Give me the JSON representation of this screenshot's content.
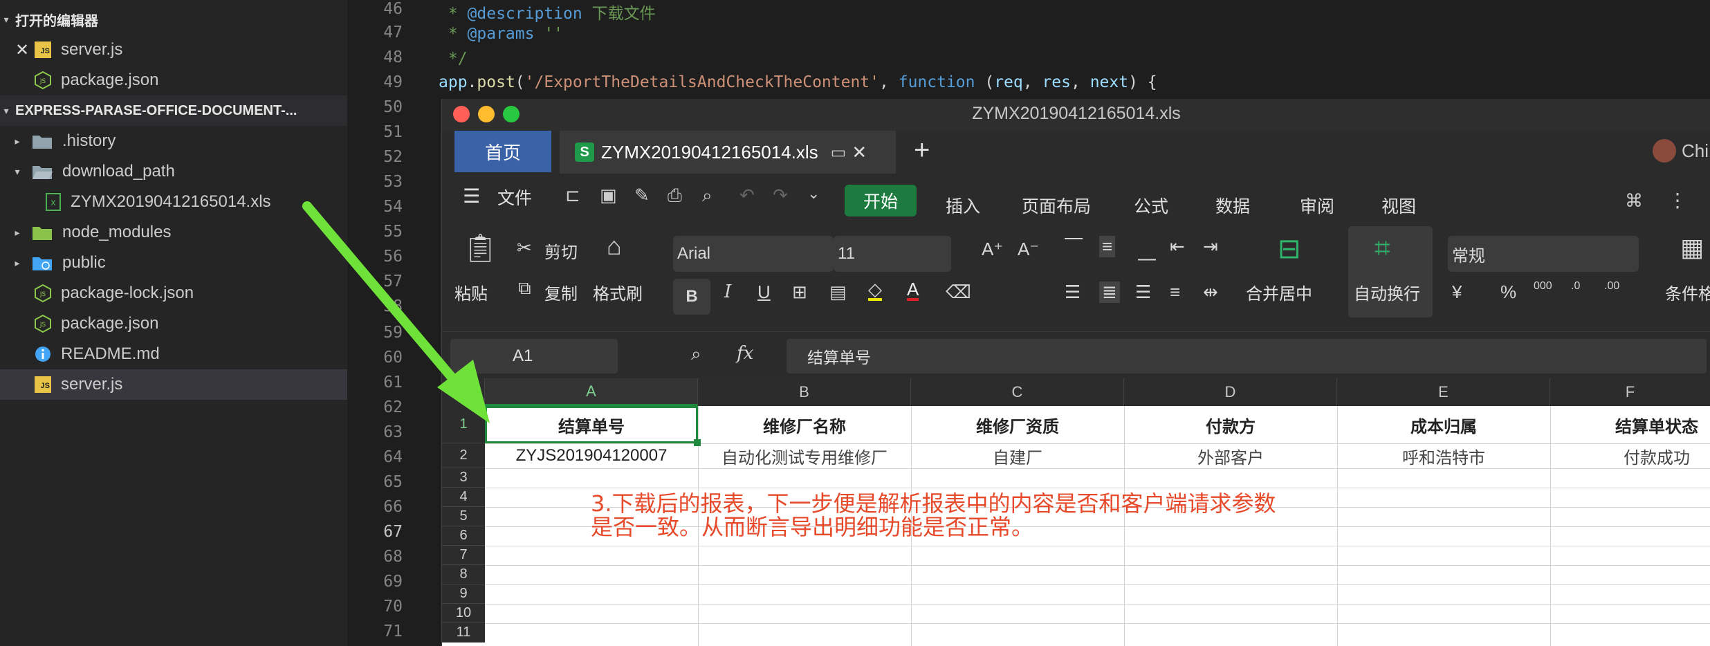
{
  "sidebar": {
    "open_editors_title": "打开的编辑器",
    "open_editors": [
      {
        "label": "server.js",
        "icon": "js-file-icon"
      },
      {
        "label": "package.json",
        "icon": "node-file-icon"
      }
    ],
    "project_title": "EXPRESS-PARASE-OFFICE-DOCUMENT-...",
    "tree": [
      {
        "label": ".history",
        "icon": "folder-icon"
      },
      {
        "label": "download_path",
        "icon": "folder-open-icon"
      },
      {
        "label": "ZYMX20190412165014.xls",
        "icon": "excel-file-icon"
      },
      {
        "label": "node_modules",
        "icon": "node-folder-icon"
      },
      {
        "label": "public",
        "icon": "web-folder-icon"
      },
      {
        "label": "package-lock.json",
        "icon": "node-file-icon"
      },
      {
        "label": "package.json",
        "icon": "node-file-icon"
      },
      {
        "label": "README.md",
        "icon": "info-icon"
      },
      {
        "label": "server.js",
        "icon": "js-file-icon"
      }
    ]
  },
  "editor": {
    "line_numbers": [
      "46",
      "47",
      "48",
      "49",
      "50",
      "51",
      "52",
      "53",
      "54",
      "55",
      "56",
      "57",
      "58",
      "59",
      "60",
      "61",
      "62",
      "63",
      "64",
      "65",
      "66",
      "67",
      "68",
      "69",
      "70",
      "71"
    ],
    "current_line": "67",
    "line46": {
      "star": " * ",
      "tag": "@description",
      "text": " 下载文件"
    },
    "line47": {
      "star": " * ",
      "tag": "@params",
      "text": " ''"
    },
    "line48": " */",
    "line49": {
      "obj": "app",
      "dot": ".",
      "method": "post",
      "open": "(",
      "route": "'/ExportTheDetailsAndCheckTheContent'",
      "comma": ", ",
      "kw": "function",
      "params_open": " (",
      "p1": "req",
      "sep1": ", ",
      "p2": "res",
      "sep2": ", ",
      "p3": "next",
      "close": ") {"
    }
  },
  "wps": {
    "window_title": "ZYMX20190412165014.xls",
    "tab_home": "首页",
    "tab_doc": "ZYMX20190412165014.xls",
    "tab_add": "+",
    "user_label": "Chi",
    "menu": {
      "file": "文件",
      "start": "开始",
      "items": [
        "插入",
        "页面布局",
        "公式",
        "数据",
        "审阅",
        "视图"
      ]
    },
    "ribbon": {
      "paste": "粘贴",
      "cut": "剪切",
      "copy": "复制",
      "format_painter": "格式刷",
      "font_name": "Arial",
      "font_size": "11",
      "merge_center": "合并居中",
      "wrap_text": "自动换行",
      "number_format": "常规",
      "conditional": "条件格",
      "bold": "B",
      "italic": "I",
      "underline": "U"
    },
    "formula_bar": {
      "name_box": "A1",
      "fx": "fx",
      "content": "结算单号"
    },
    "columns": [
      "A",
      "B",
      "C",
      "D",
      "E",
      "F"
    ],
    "rows": [
      "1",
      "2",
      "3",
      "4",
      "5",
      "6",
      "7",
      "8",
      "9",
      "10",
      "11"
    ],
    "header_row": [
      "结算单号",
      "维修厂名称",
      "维修厂资质",
      "付款方",
      "成本归属",
      "结算单状态"
    ],
    "data_row": [
      "ZYJS201904120007",
      "自动化测试专用维修厂",
      "自建厂",
      "外部客户",
      "呼和浩特市",
      "付款成功"
    ],
    "annotation_line1": "3.下载后的报表，下一步便是解析报表中的内容是否和客户端请求参数",
    "annotation_line2": "是否一致。从而断言导出明细功能是否正常。"
  },
  "colors": {
    "accent_green": "#1d7b3f",
    "tab_blue": "#3a62a6",
    "annotation_red": "#e64a2b",
    "arrow_green": "#6fe23a"
  }
}
